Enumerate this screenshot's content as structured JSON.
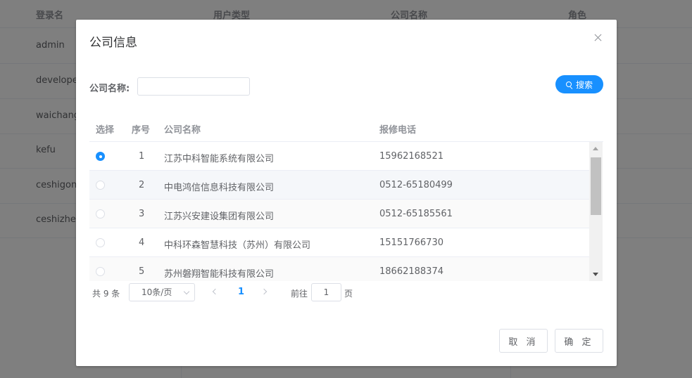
{
  "background_table": {
    "headers": [
      "登录名",
      "用户类型",
      "公司名称",
      "角色"
    ],
    "rows": [
      "admin",
      "developer",
      "waichangw",
      "kefu",
      "ceshigong",
      "ceshizhen"
    ]
  },
  "dialog": {
    "title": "公司信息",
    "search": {
      "label": "公司名称:",
      "value": "",
      "button_label": "搜索"
    },
    "table": {
      "headers": {
        "select": "选择",
        "index": "序号",
        "company": "公司名称",
        "phone": "报修电话"
      },
      "rows": [
        {
          "index": "1",
          "company": "江苏中科智能系统有限公司",
          "phone": "15962168521",
          "selected": true
        },
        {
          "index": "2",
          "company": "中电鸿信信息科技有限公司",
          "phone": "0512-65180499",
          "selected": false
        },
        {
          "index": "3",
          "company": "江苏兴安建设集团有限公司",
          "phone": "0512-65185561",
          "selected": false
        },
        {
          "index": "4",
          "company": "中科环森智慧科技（苏州）有限公司",
          "phone": "15151766730",
          "selected": false
        },
        {
          "index": "5",
          "company": "苏州磐翔智能科技有限公司",
          "phone": "18662188374",
          "selected": false
        }
      ]
    },
    "pagination": {
      "total": "共 9 条",
      "page_size": "10条/页",
      "current_page": "1",
      "goto_label": "前往",
      "goto_value": "1",
      "page_suffix": "页"
    },
    "buttons": {
      "cancel": "取 消",
      "confirm": "确 定"
    }
  },
  "colors": {
    "primary": "#1890ff",
    "overlay": "rgba(0,0,0,0.5)"
  }
}
